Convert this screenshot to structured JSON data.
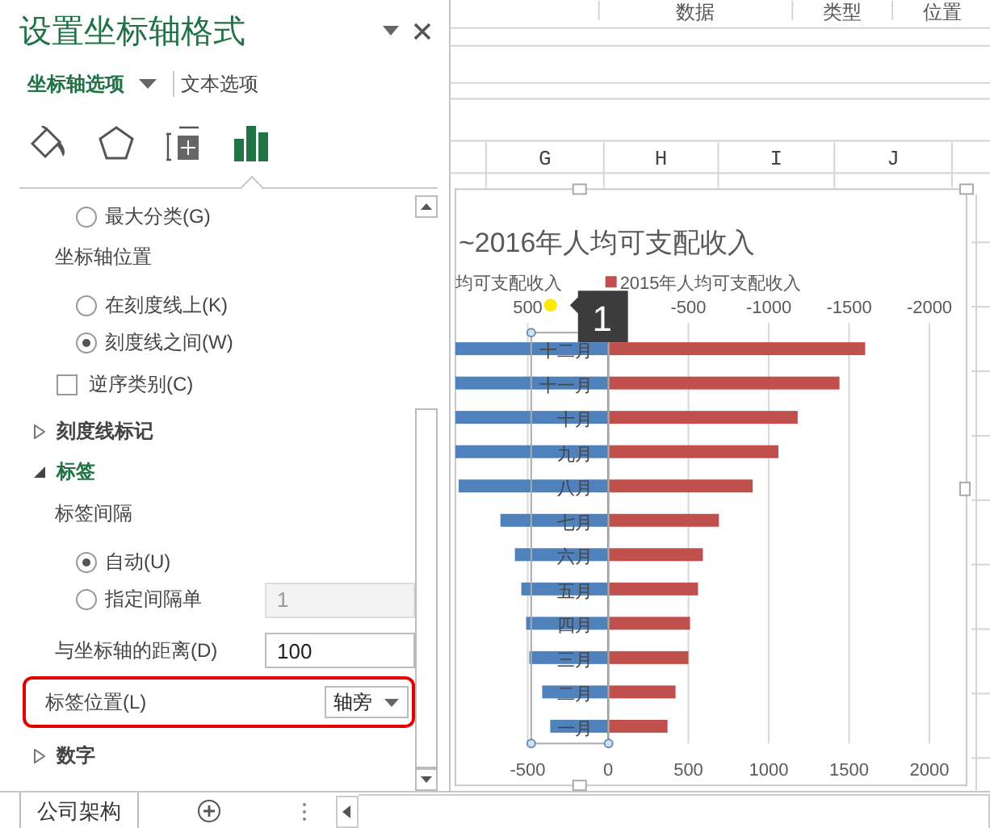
{
  "pane": {
    "title": "设置坐标轴格式",
    "tabs": [
      {
        "label": "坐标轴选项",
        "selected": true,
        "menu": true
      },
      {
        "label": "文本选项",
        "selected": false,
        "menu": false
      }
    ],
    "icon_tabs": [
      {
        "kind": "fill",
        "selected": false
      },
      {
        "kind": "shape",
        "selected": false
      },
      {
        "kind": "size",
        "selected": false
      },
      {
        "kind": "bars",
        "selected": true
      }
    ],
    "items": [
      {
        "kind": "radio",
        "label": "最大分类(G)",
        "selected": false
      },
      {
        "kind": "label",
        "label": "坐标轴位置"
      },
      {
        "kind": "radio",
        "label": "在刻度线上(K)",
        "selected": false
      },
      {
        "kind": "radio",
        "label": "刻度线之间(W)",
        "selected": true
      },
      {
        "kind": "checkbox",
        "label": "逆序类别(C)",
        "checked": false
      },
      {
        "kind": "section",
        "label": "刻度线标记",
        "expanded": false
      },
      {
        "kind": "section",
        "label": "标签",
        "expanded": true
      },
      {
        "kind": "label",
        "label": "标签间隔"
      },
      {
        "kind": "radio",
        "label": "自动(U)",
        "selected": true
      },
      {
        "kind": "radio-field",
        "label": "指定间隔单",
        "selected": false,
        "value": "1",
        "disabled": true
      },
      {
        "kind": "field",
        "label": "与坐标轴的距离(D)",
        "value": "100",
        "disabled": false
      },
      {
        "kind": "dropdown",
        "label": "标签位置(L)",
        "value": "轴旁",
        "highlighted": true
      },
      {
        "kind": "section",
        "label": "数字",
        "expanded": false
      }
    ]
  },
  "sheet": {
    "top_headers": [
      "数据",
      "类型",
      "位置"
    ],
    "columns": [
      "G",
      "H",
      "I",
      "J"
    ],
    "tabs": [
      {
        "label": "公司架构",
        "selected": true
      }
    ]
  },
  "chart": {
    "tooltip": "1",
    "chart_data": {
      "type": "bar",
      "orientation": "horizontal",
      "title": "~2016年人均可支配收入",
      "categories": [
        "十二月",
        "十一月",
        "十月",
        "九月",
        "八月",
        "七月",
        "六月",
        "五月",
        "四月",
        "三月",
        "二月",
        "一月"
      ],
      "series": [
        {
          "name": "均可支配收入",
          "color": "#4f81bd",
          "values": [
            -950,
            -950,
            -950,
            -950,
            -930,
            -670,
            -580,
            -540,
            -510,
            -490,
            -410,
            -360
          ]
        },
        {
          "name": "2015年人均可支配收入",
          "color": "#c0504d",
          "values": [
            1600,
            1440,
            1180,
            1060,
            900,
            690,
            590,
            560,
            510,
            500,
            420,
            370
          ]
        }
      ],
      "xlim": [
        -950,
        2000
      ],
      "xticks": [
        -500,
        0,
        500,
        1000,
        1500,
        2000
      ],
      "x2lim": [
        950,
        -2000
      ],
      "x2ticks": [
        500,
        -500,
        -1000,
        -1500,
        -2000
      ],
      "stacked": true,
      "grid": true
    }
  }
}
